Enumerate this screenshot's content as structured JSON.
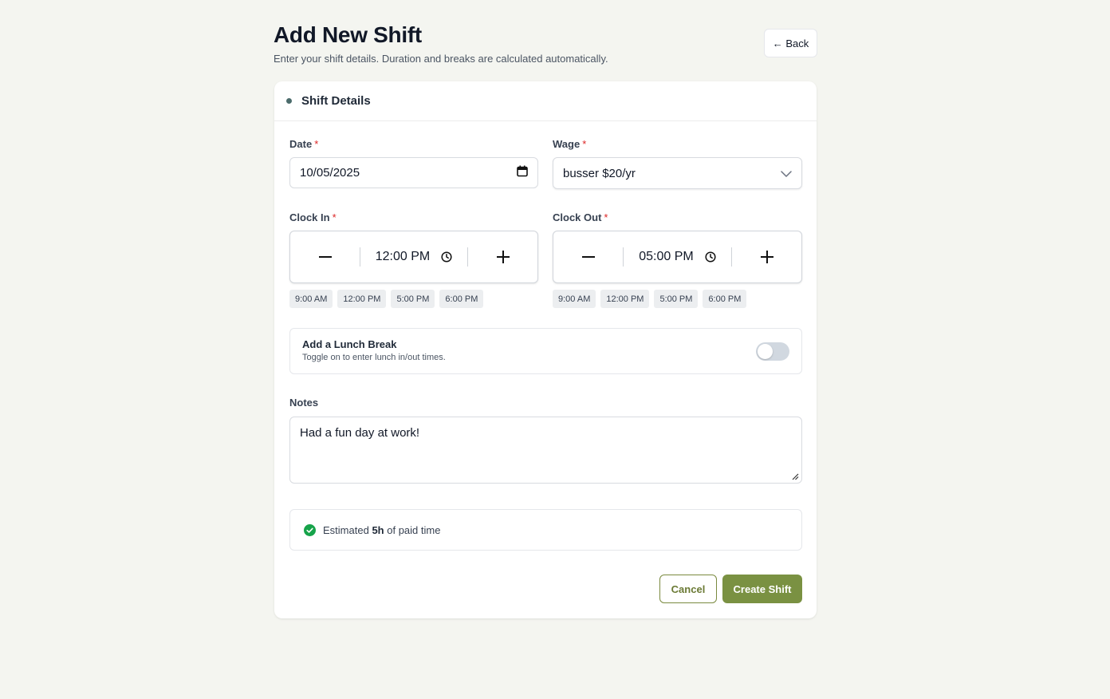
{
  "page": {
    "title": "Add New Shift",
    "subtitle": "Enter your shift details. Duration and breaks are calculated automatically.",
    "back_label": "← Back"
  },
  "card": {
    "title": "Shift Details"
  },
  "fields": {
    "date": {
      "label": "Date",
      "required_mark": "*",
      "value": "10/05/2025",
      "icon": "calendar-icon"
    },
    "wage": {
      "label": "Wage",
      "required_mark": "*",
      "value": "busser $20/yr",
      "icon": "chevron-down-icon"
    },
    "clock_in": {
      "label": "Clock In",
      "required_mark": "*",
      "value": "12:00 PM",
      "presets": [
        "9:00 AM",
        "12:00 PM",
        "5:00 PM",
        "6:00 PM"
      ]
    },
    "clock_out": {
      "label": "Clock Out",
      "required_mark": "*",
      "value": "05:00 PM",
      "presets": [
        "9:00 AM",
        "12:00 PM",
        "5:00 PM",
        "6:00 PM"
      ]
    },
    "notes": {
      "label": "Notes",
      "value": "Had a fun day at work!"
    }
  },
  "lunch": {
    "title": "Add a Lunch Break",
    "description": "Toggle on to enter lunch in/out times.",
    "enabled": false
  },
  "estimate": {
    "prefix": "Estimated",
    "hours": "5h",
    "suffix": "of paid time",
    "icon": "check-circle-icon"
  },
  "actions": {
    "cancel_label": "Cancel",
    "create_label": "Create Shift"
  },
  "colors": {
    "accent": "#7a9142",
    "background": "#f4f5f0",
    "success": "#16a34a",
    "required": "#dc2626"
  }
}
